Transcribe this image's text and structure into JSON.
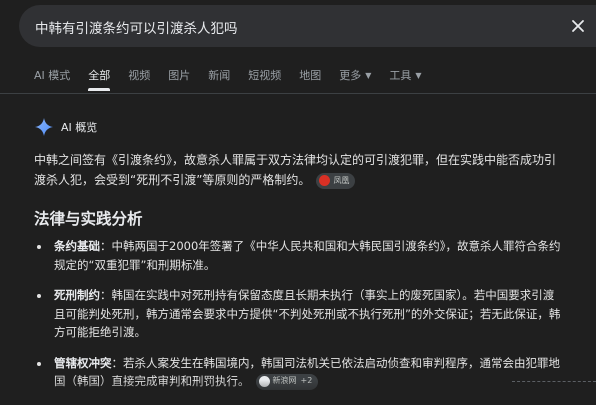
{
  "search": {
    "query": "中韩有引渡条约可以引渡杀人犯吗"
  },
  "tabs": [
    {
      "label": "AI 模式",
      "active": false
    },
    {
      "label": "全部",
      "active": true
    },
    {
      "label": "视频",
      "active": false
    },
    {
      "label": "图片",
      "active": false
    },
    {
      "label": "新闻",
      "active": false
    },
    {
      "label": "短视频",
      "active": false
    },
    {
      "label": "地图",
      "active": false
    },
    {
      "label": "更多",
      "active": false,
      "dropdown": true
    },
    {
      "label": "工具",
      "active": false,
      "dropdown": true
    }
  ],
  "ai_overview": {
    "title": "AI 概览",
    "summary": "中韩之间签有《引渡条约》，故意杀人罪属于双方法律均认定的可引渡犯罪，但在实践中能否成功引渡杀人犯，会受到“死刑不引渡”等原则的严格制约。",
    "summary_source": "凤凰",
    "section_heading": "法律与实践分析",
    "bullets": [
      {
        "term": "条约基础",
        "text": "：中韩两国于2000年签署了《中华人民共和国和大韩民国引渡条约》，故意杀人罪符合条约规定的“双重犯罪”和刑期标准。"
      },
      {
        "term": "死刑制约",
        "text": "：韩国在实践中对死刑持有保留态度且长期未执行（事实上的废死国家）。若中国要求引渡且可能判处死刑，韩方通常会要求中方提供“不判处死刑或不执行死刑”的外交保证；若无此保证，韩方可能拒绝引渡。"
      },
      {
        "term": "管辖权冲突",
        "text": "：若杀人案发生在韩国境内，韩国司法机关已依法启动侦查和审判程序，通常会由犯罪地国（韩国）直接完成审判和刑罚执行。",
        "source": "新浪网",
        "source_more": "+2"
      }
    ]
  },
  "colors": {
    "background": "#1f1f1f",
    "searchbar": "#303134",
    "text": "#e3e3e3",
    "muted": "#9aa0a6",
    "accent_spark": "#4f8df9"
  }
}
